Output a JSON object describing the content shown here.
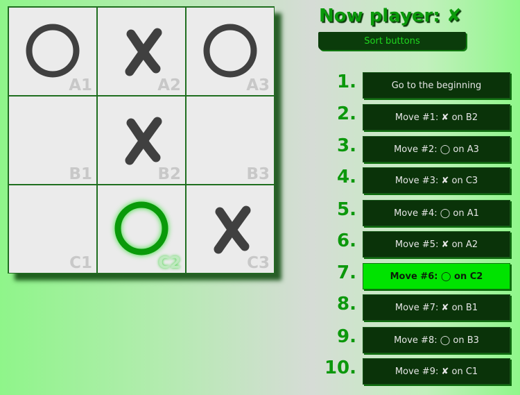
{
  "status": {
    "label": "Now player:",
    "symbol": "✘"
  },
  "sort_button": "Sort buttons",
  "board": [
    {
      "coord": "A1",
      "mark": "O"
    },
    {
      "coord": "A2",
      "mark": "X"
    },
    {
      "coord": "A3",
      "mark": "O"
    },
    {
      "coord": "B1",
      "mark": ""
    },
    {
      "coord": "B2",
      "mark": "X"
    },
    {
      "coord": "B3",
      "mark": ""
    },
    {
      "coord": "C1",
      "mark": ""
    },
    {
      "coord": "C2",
      "mark": "O",
      "highlight": true
    },
    {
      "coord": "C3",
      "mark": "X"
    }
  ],
  "moves": [
    {
      "number": "1.",
      "label": "Go to the beginning"
    },
    {
      "number": "2.",
      "label": "Move #1: ✘ on B2"
    },
    {
      "number": "3.",
      "label": "Move #2: ◯ on A3"
    },
    {
      "number": "4.",
      "label": "Move #3: ✘ on C3"
    },
    {
      "number": "5.",
      "label": "Move #4: ◯ on A1"
    },
    {
      "number": "6.",
      "label": "Move #5: ✘ on A2"
    },
    {
      "number": "7.",
      "label": "Move #6: ◯ on C2",
      "current": true
    },
    {
      "number": "8.",
      "label": "Move #7: ✘ on B1"
    },
    {
      "number": "9.",
      "label": "Move #8: ◯ on B3"
    },
    {
      "number": "10.",
      "label": "Move #9: ✘ on C1"
    }
  ],
  "colors": {
    "piece": "#404040",
    "highlight_piece": "#0a9a0a",
    "current_move_bg": "#00e300",
    "move_bg": "#0a3309"
  }
}
